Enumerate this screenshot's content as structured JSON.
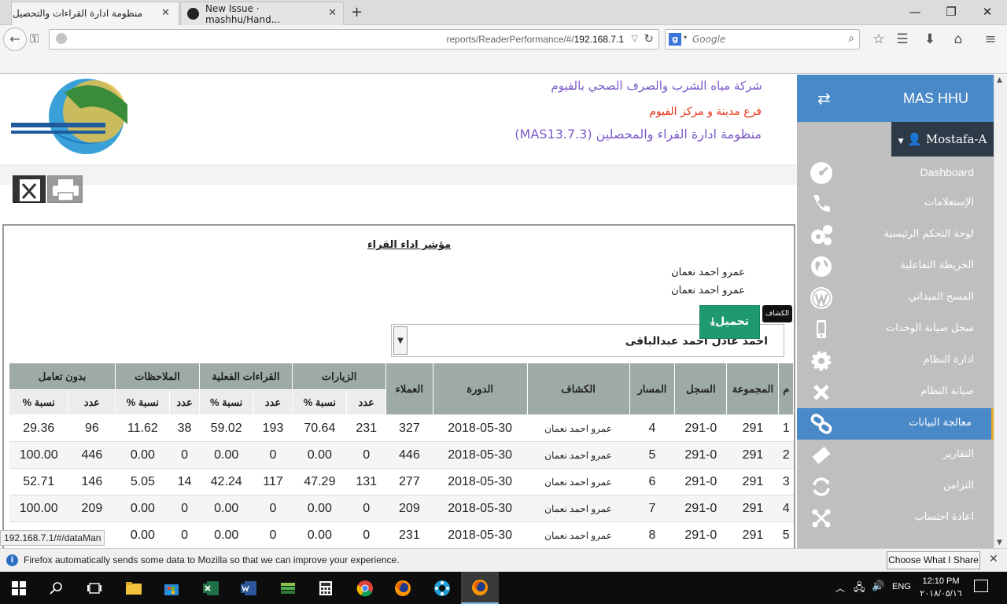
{
  "browser": {
    "tabs": [
      {
        "title": "منظومة ادارة القراءات والتحصيل",
        "active": true
      },
      {
        "title": "New Issue · mashhu/Hand...",
        "active": false
      }
    ],
    "new_tab": "+",
    "url_path": "reports/ReaderPerformance/#/",
    "url_host": "192.168.7.1",
    "search_placeholder": "Google",
    "window_controls": [
      "—",
      "❐",
      "✕"
    ]
  },
  "header": {
    "company": "شركة مياه الشرب والصرف الصحي بالفيوم",
    "branch": "فرع مدينة و مركز الفيوم",
    "system_name": "منظومة ادارة القراء والمحصلين (",
    "version": "MAS13.7.3",
    "system_close": ")"
  },
  "sidebar": {
    "brand": "MAS HHU",
    "user": "Mostafa-A",
    "items": [
      {
        "label": "Dashboard",
        "icon": "dashboard-icon",
        "active": false
      },
      {
        "label": "الإستعلامات",
        "icon": "phone-icon",
        "active": false
      },
      {
        "label": "لوحة التحكم الرئيسية",
        "icon": "gears-icon",
        "active": false
      },
      {
        "label": "الخريطة التفاعلية",
        "icon": "globe-icon",
        "active": false
      },
      {
        "label": "المسح الميداني",
        "icon": "wordpress-icon",
        "active": false
      },
      {
        "label": "سجل صيانة الوحدات",
        "icon": "mobile-icon",
        "active": false
      },
      {
        "label": "ادارة النظام",
        "icon": "gear-icon",
        "active": false
      },
      {
        "label": "صيانة النظام",
        "icon": "cross-icon",
        "active": false
      },
      {
        "label": "معالجة البيانات",
        "icon": "link-icon",
        "active": true
      },
      {
        "label": "التقارير",
        "icon": "ticket-icon",
        "active": false
      },
      {
        "label": "التزامن",
        "icon": "sync-icon",
        "active": false
      },
      {
        "label": "اعادة احتساب",
        "icon": "molecule-icon",
        "active": false
      }
    ]
  },
  "report": {
    "title": "مؤشر اداء القراء",
    "names": [
      "عمرو احمد نعمان",
      "عمرو احمد نعمان"
    ],
    "selected_reader": "احمد عادل احمد عبدالباقى",
    "download_label": "تحميل",
    "tooltip": "الكشاف",
    "group_headers": {
      "visits": "الزيارات",
      "actual_reads": "القراءات الفعلية",
      "notes": "الملاحظات",
      "no_deal": "بدون تعامل"
    },
    "columns": {
      "num": "م",
      "group": "المجموعة",
      "register": "السجل",
      "path": "المسار",
      "reader": "الكشاف",
      "cycle": "الدورة",
      "customers": "العملاء",
      "count": "عدد",
      "percent": "نسبة %"
    },
    "rows": [
      {
        "num": "1",
        "group": "291",
        "register": "291-0",
        "path": "4",
        "reader": "عمرو احمد نعمان",
        "cycle": "2018-05-30",
        "customers": "327",
        "visits_n": "231",
        "visits_p": "70.64",
        "reads_n": "193",
        "reads_p": "59.02",
        "notes_n": "38",
        "notes_p": "11.62",
        "nodeal_n": "96",
        "nodeal_p": "29.36"
      },
      {
        "num": "2",
        "group": "291",
        "register": "291-0",
        "path": "5",
        "reader": "عمرو احمد نعمان",
        "cycle": "2018-05-30",
        "customers": "446",
        "visits_n": "0",
        "visits_p": "0.00",
        "reads_n": "0",
        "reads_p": "0.00",
        "notes_n": "0",
        "notes_p": "0.00",
        "nodeal_n": "446",
        "nodeal_p": "100.00"
      },
      {
        "num": "3",
        "group": "291",
        "register": "291-0",
        "path": "6",
        "reader": "عمرو احمد نعمان",
        "cycle": "2018-05-30",
        "customers": "277",
        "visits_n": "131",
        "visits_p": "47.29",
        "reads_n": "117",
        "reads_p": "42.24",
        "notes_n": "14",
        "notes_p": "5.05",
        "nodeal_n": "146",
        "nodeal_p": "52.71"
      },
      {
        "num": "4",
        "group": "291",
        "register": "291-0",
        "path": "7",
        "reader": "عمرو احمد نعمان",
        "cycle": "2018-05-30",
        "customers": "209",
        "visits_n": "0",
        "visits_p": "0.00",
        "reads_n": "0",
        "reads_p": "0.00",
        "notes_n": "0",
        "notes_p": "0.00",
        "nodeal_n": "209",
        "nodeal_p": "100.00"
      },
      {
        "num": "5",
        "group": "291",
        "register": "291-0",
        "path": "8",
        "reader": "عمرو احمد نعمان",
        "cycle": "2018-05-30",
        "customers": "231",
        "visits_n": "0",
        "visits_p": "0.00",
        "reads_n": "0",
        "reads_p": "0.00",
        "notes_n": "0",
        "notes_p": "0.00",
        "nodeal_n": "",
        "nodeal_p": ""
      }
    ]
  },
  "status_url": "192.168.7.1/#/dataMan",
  "notification": {
    "text": "Firefox automatically sends some data to Mozilla so that we can improve your experience.",
    "button": "Choose What I Share"
  },
  "taskbar": {
    "time": "12:10 PM",
    "date": "٢٠١٨/٠٥/١٦",
    "lang": "ENG"
  },
  "colors": {
    "sidebar_bg": "#bfbfbf",
    "sidebar_accent": "#4a89c8",
    "table_header": "#9eaba5",
    "download_button": "#1f9a70"
  }
}
